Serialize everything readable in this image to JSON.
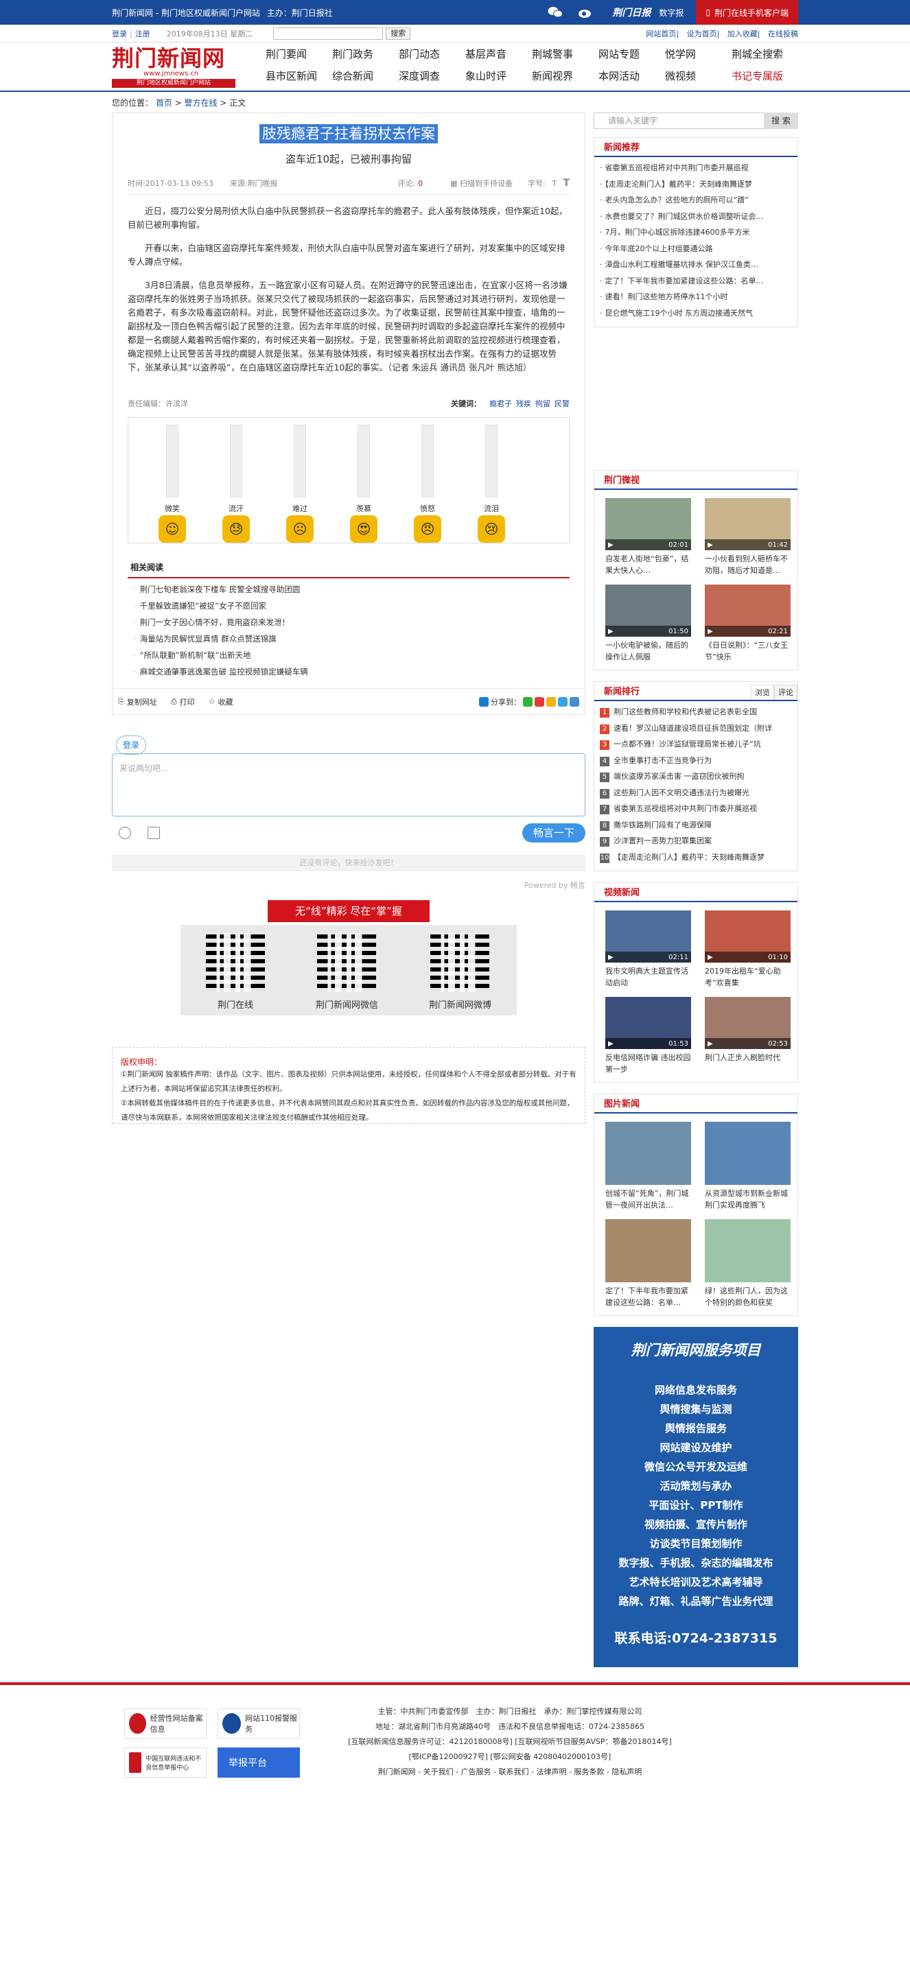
{
  "topbar": {
    "site": "荆门新闻网 - 荆门地区权威新闻门户网站",
    "sponsor": "主办：荆门日报社",
    "brand": "荆门日报",
    "digital": "数字报",
    "mobile": "荆门在线手机客户端"
  },
  "subbar": {
    "login": "登录",
    "register": "注册",
    "date": "2019年08月13日 星期二",
    "search_btn": "搜索",
    "links": [
      "网站首页",
      "设为首页",
      "加入收藏",
      "在线投稿"
    ]
  },
  "logo": {
    "title": "荆门新闻网",
    "url": "www.jmnews.cn",
    "slogan": "荆门地区权威新闻门户网站"
  },
  "nav": {
    "row1": [
      "荆门要闻",
      "荆门政务",
      "部门动态",
      "基层声音",
      "荆城警事",
      "网站专题",
      "悦学网",
      "荆城全搜索"
    ],
    "row2": [
      "县市区新闻",
      "综合新闻",
      "深度调查",
      "象山时评",
      "新闻视界",
      "本网活动",
      "微视频",
      "书记专属版"
    ]
  },
  "crumb": {
    "label": "您的位置：",
    "home": "首页",
    "section": "警方在线",
    "current": "正文"
  },
  "article": {
    "title": "肢残瘾君子拄着拐杖去作案",
    "subtitle": "盗车近10起，已被刑事拘留",
    "time": "时间:2017-03-13 09:53",
    "source": "来源:荆门晚报",
    "comment_label": "评论:",
    "comment_count": "0",
    "scan": "扫描到手持设备",
    "fontsize": "字号:",
    "paragraphs": [
      "近日，掇刀公安分局刑侦大队白庙中队民警抓获一名盗窃摩托车的瘾君子。此人虽有肢体残疾，但作案近10起，目前已被刑事拘留。",
      "开春以来，白庙辖区盗窃摩托车案件频发，刑侦大队白庙中队民警对盗车案进行了研判，对发案集中的区域安排专人蹲点守候。",
      "3月8日清晨，信息员举报称，五一路宜家小区有可疑人员。在附近蹲守的民警迅速出击，在宜家小区将一名涉嫌盗窃摩托车的张姓男子当场抓获。张某只交代了被现场抓获的一起盗窃事实，后民警通过对其进行研判，发现他是一名瘾君子，有多次吸毒盗窃前科。对此，民警怀疑他还盗窃过多次。为了收集证据，民警前往其案中搜查，墙角的一副拐杖及一顶白色鸭舌帽引起了民警的注意。因为去年年底的时候，民警研判时调取的多起盗窃摩托车案件的视频中都是一名瘸腿人戴着鸭舌帽作案的，有时候还夹着一副拐杖。于是，民警重新将此前调取的监控视频进行梳理查看，确定视频上让民警苦苦寻找的瘸腿人就是张某。张某有肢体残疾，有时候夹着拐杖出去作案。在强有力的证据攻势下，张某承认其“以盗养吸”，在白庙辖区盗窃摩托车近10起的事实。（记者 朱运兵 通讯员 张凡叶 熊达旭）"
    ],
    "editor": "责任编辑：许滨洋",
    "keywords_label": "关键词：",
    "keywords": [
      "瘾君子",
      "残疾",
      "拘留",
      "民警"
    ]
  },
  "moods": [
    {
      "label": "微笑",
      "icon": "smile-icon"
    },
    {
      "label": "流汗",
      "icon": "sweat-icon"
    },
    {
      "label": "难过",
      "icon": "sad-icon"
    },
    {
      "label": "羡慕",
      "icon": "love-icon"
    },
    {
      "label": "愤怒",
      "icon": "angry-icon"
    },
    {
      "label": "流泪",
      "icon": "cry-icon"
    }
  ],
  "related": {
    "title": "相关阅读",
    "items": [
      "荆门七旬老翁深夜下楼车 民警全城搜寻助团圆",
      "千里躲致遗嫌犯“被捉”女子不愿回家",
      "荆门一女子因心情不好，竟用盗窃来发泄！",
      "海量站为民解忧显真情 群众点赞送锦旗",
      "“所队联勤”新机制“联”出新天地",
      "麻城交通肇事逃逸案告破 监控视频锁定嫌疑车辆"
    ]
  },
  "tools": {
    "copy": "复制网址",
    "print": "打印",
    "fav": "收藏",
    "share": "分享到："
  },
  "comment": {
    "login": "登录",
    "placeholder": "来说两句吧…",
    "send": "畅言一下",
    "empty": "还没有评论，快来抢沙发吧！",
    "powered": "Powered by 畅言"
  },
  "qr": {
    "title": "无“线”精彩 尽在“掌”握",
    "items": [
      "荆门在线",
      "荆门新闻网微信",
      "荆门新闻网微博"
    ]
  },
  "copyright": {
    "title": "版权申明：",
    "lines": [
      "①荆门新闻网 独家稿件声明：该作品（文字、图片、图表及视频）只供本网站使用，未经授权，任何媒体和个人不得全部或者部分转载。对于有上述行为者，本网站将保留追究其法律责任的权利。",
      "②本网转载其他媒体稿件目的在于传递更多信息，并不代表本网赞同其观点和对其真实性负责。如因转载的作品内容涉及您的版权或其他问题，请尽快与本网联系，本网将依照国家相关法律法规支付稿酬或作其他相应处理。"
    ]
  },
  "sidebar": {
    "search_placeholder": "请输入关键字",
    "search_btn": "搜 索",
    "recommend": {
      "title": "新闻推荐",
      "items": [
        "省委第五巡视组将对中共荆门市委开展巡视",
        "【走周走沦荆门人】戴药平：天刻峰南舞逐梦",
        "老头内急怎么办？这些地方的厕所可以“蹭”",
        "水费也要交了？荆门城区供水价格调整听证会…",
        "7月，荆门中心城区拆除违建4600多平方米",
        "今年年底20个以上村组要通公路",
        "漳盘山水利工程撤堰基坑排水 保护汉江鱼类…",
        "定了！下半年我市要加紧建设这些公路：名单…",
        "速看！荆门这些地方将停水11个小时",
        "昆仑燃气施工19个小时 东方周边接通天然气"
      ]
    },
    "video": {
      "title": "荆门微视",
      "items": [
        {
          "caption": "自发老人街地“包豪”，结果大快人心…",
          "time": "02:01"
        },
        {
          "caption": "一小伙看到别人砸桥车不劝阻，随后才知道是…",
          "time": "01:42"
        },
        {
          "caption": "一小伙电驴被偷，随后的操作让人佩服",
          "time": "01:50"
        },
        {
          "caption": "《日日说荆》：“三八女王节”快乐",
          "time": "02:21"
        }
      ]
    },
    "rank": {
      "title": "新闻排行",
      "tabs": [
        "浏览",
        "评论"
      ],
      "items": [
        "荆门这些教师和学校和代表被记名表彰全国",
        "速看！罗汉山隧道建设项目征拆范围划定（附详",
        "一点都不雅！沙洋监狱管理局常长被儿子“坑",
        "全市重事打击不正当竞争行为",
        "端伙盗摩苏家溪击害 一盗窃团伙被刑拘",
        "这些荆门人因不文明交通违法行为被曝光",
        "省委第五巡视组将对中共荆门市委开展巡视",
        "撒华铁路荆门段有了电源保障",
        "沙洋置判一恶势力犯罪集团案",
        "【走周走沦荆门人】戴药平：天刻峰南舞逐梦"
      ]
    },
    "vnews": {
      "title": "视频新闻",
      "items": [
        {
          "caption": "我市文明典大主题宣传活动启动",
          "time": "02:11"
        },
        {
          "caption": "2019年出租车“爱心助考”欢喜集",
          "time": "01:10"
        },
        {
          "caption": "反电信网络诈骗 违出校园第一步",
          "time": "01:53"
        },
        {
          "caption": "荆门人正步入刷脸时代",
          "time": "02:53"
        }
      ]
    },
    "photos": {
      "title": "图片新闻",
      "items": [
        "创城不留“死角”，荆门城管一夜间开出执法…",
        "从资源型城市到新业新城 荆门实现再度腾飞",
        "定了！下半年我市要加紧建设这些公路：名单…",
        "绿！这些荆门人，因为这个特别的颜色和获奖"
      ]
    },
    "ad": {
      "title": "荆门新闻网服务项目",
      "services": [
        "网络信息发布服务",
        "舆情搜集与监测",
        "舆情报告服务",
        "网站建设及维护",
        "微信公众号开发及运维",
        "活动策划与承办",
        "平面设计、PPT制作",
        "视频拍摄、宣传片制作",
        "访谈类节目策划制作",
        "数字报、手机报、杂志的编辑发布",
        "艺术特长培训及艺术高考辅导",
        "路牌、灯箱、礼品等广告业务代理"
      ],
      "phone": "联系电话:0724-2387315"
    }
  },
  "footer": {
    "badges": [
      "经营性网站备案信息",
      "网站110报警服务",
      "中国互联网违法和不良信息举报中心",
      "举报平台"
    ],
    "lines": [
      "主管：中共荆门市委宣传部　主办：荆门日报社　承办：荆门掌控传媒有限公司",
      "地址：湖北省荆门市月亮湖路40号　违法和不良信息举报电话：0724-2385865",
      "[互联网新闻信息服务许可证：42120180008号]  [互联网视听节目服务AVSP：鄂备2018014号]",
      "[鄂ICP备12000927号]  [鄂公网安备 42080402000103号]",
      "荆门新闻网 - 关于我们 - 广告服务 - 联系我们 - 法律声明 - 服务条款 - 隐私声明"
    ]
  }
}
